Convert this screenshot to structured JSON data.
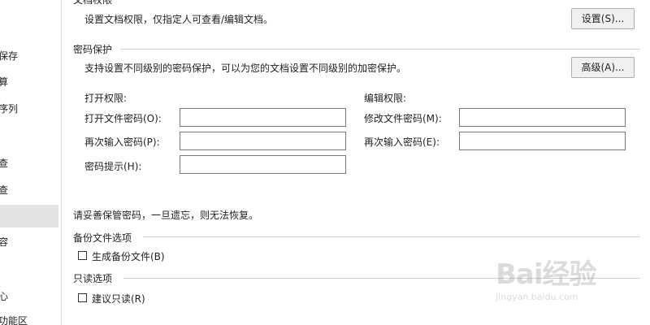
{
  "sidebar": {
    "items": [
      {
        "label": "保存"
      },
      {
        "label": "算"
      },
      {
        "label": "序列"
      },
      {
        "label": "查"
      },
      {
        "label": "查"
      },
      {
        "label": ""
      },
      {
        "label": "容"
      },
      {
        "label": "心"
      },
      {
        "label": "功能区"
      }
    ]
  },
  "doc_permission": {
    "title": "文档权限",
    "description": "设置文档权限，仅指定人可查看/编辑文档。",
    "button_label": "设置(S)..."
  },
  "password_protection": {
    "title": "密码保护",
    "description": "支持设置不同级别的密码保护，可以为您的文档设置不同级别的加密保护。",
    "advanced_button_label": "高级(A)...",
    "open_permission": {
      "heading": "打开权限:",
      "password_label": "打开文件密码(O):",
      "password_value": "",
      "confirm_label": "再次输入密码(P):",
      "confirm_value": "",
      "hint_label": "密码提示(H):",
      "hint_value": ""
    },
    "edit_permission": {
      "heading": "编辑权限:",
      "password_label": "修改文件密码(M):",
      "password_value": "",
      "confirm_label": "再次输入密码(E):",
      "confirm_value": ""
    },
    "warning": "请妥善保管密码，一旦遗忘，则无法恢复。"
  },
  "backup_options": {
    "title": "备份文件选项",
    "checkbox_label": "生成备份文件(B)",
    "checked": false
  },
  "readonly_options": {
    "title": "只读选项",
    "checkbox_label": "建议只读(R)",
    "checked": false
  },
  "watermark": {
    "brand": "Bai经验",
    "url": "jingyan.baidu.com"
  }
}
